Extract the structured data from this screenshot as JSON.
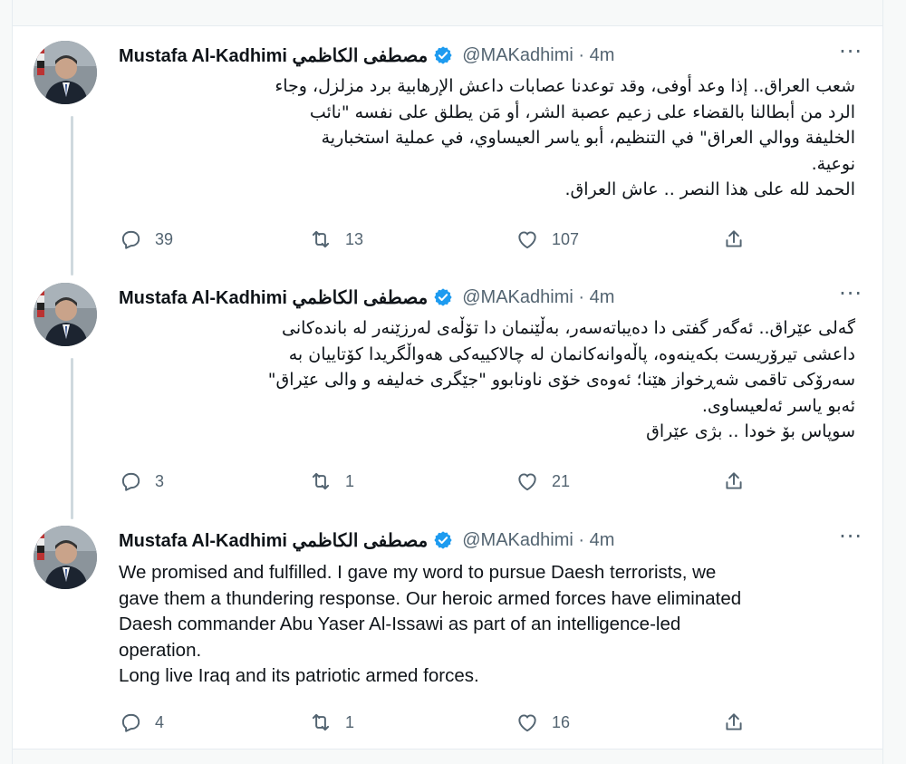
{
  "tweets": [
    {
      "name": "Mustafa Al-Kadhimi مصطفى الكاظمي",
      "handle": "@MAKadhimi · 4m",
      "text": "شعب العراق.. إذا وعد أوفى، وقد توعدنا عصابات داعش الإرهابية برد مزلزل، وجاء\nالرد من أبطالنا بالقضاء على زعيم عصبة الشر، أو مَن يطلق على نفسه \"نائب\nالخليفة ووالي العراق\" في التنظيم، أبو ياسر العيساوي، في عملية استخبارية\nنوعية.\nالحمد لله على هذا النصر .. عاش العراق.",
      "replies": "39",
      "retweets": "13",
      "likes": "107"
    },
    {
      "name": "Mustafa Al-Kadhimi مصطفى الكاظمي",
      "handle": "@MAKadhimi · 4m",
      "text": "گەلی عێراق.. ئەگەر گفتی دا دەیباتەسەر، بەڵێنمان دا تۆڵەی لەرزێنەر لە باندەکانی\nداعشی تیرۆریست بکەینەوە، پاڵەوانەکانمان لە چالاکییەکی هەواڵگریدا کۆتاییان بە\nسەرۆکی تاقمی شەڕخواز هێنا؛ ئەوەی خۆی ناونابوو \"جێگری خەلیفە و والی عێراق\"\nئەبو یاسر ئەلعیساوی.\nسوپاس بۆ خودا .. بژی عێراق",
      "replies": "3",
      "retweets": "1",
      "likes": "21"
    },
    {
      "name": "Mustafa Al-Kadhimi مصطفى الكاظمي",
      "handle": "@MAKadhimi · 4m",
      "text": "We promised and fulfilled. I gave my word to pursue Daesh terrorists, we\ngave them a thundering response. Our heroic armed forces have eliminated\nDaesh commander Abu Yaser Al-Issawi as part of an intelligence-led\noperation.\nLong live Iraq and its patriotic armed forces.",
      "replies": "4",
      "retweets": "1",
      "likes": "16"
    }
  ],
  "more_label": "···",
  "colors": {
    "verified": "#1d9bf0",
    "muted": "#536471"
  }
}
